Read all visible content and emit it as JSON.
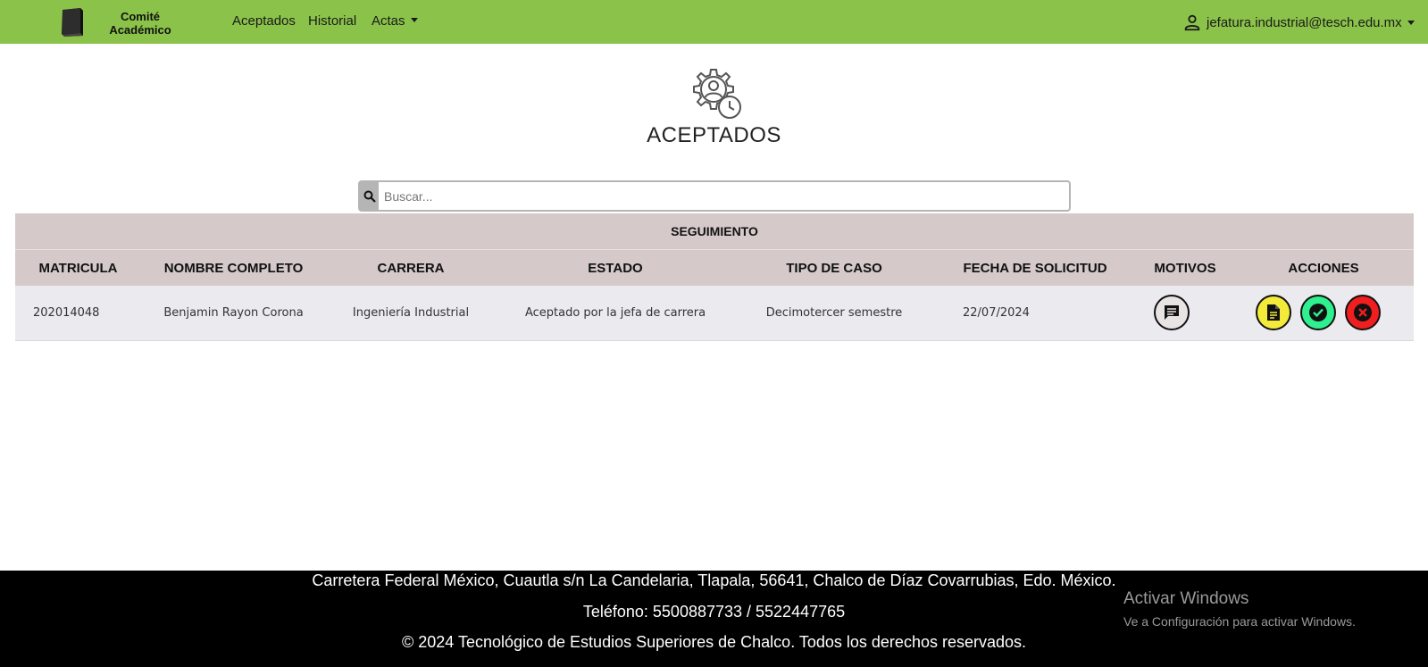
{
  "navbar": {
    "brand_line1": "Comité",
    "brand_line2": "Académico",
    "links": [
      "Aceptados",
      "Historial",
      "Actas"
    ],
    "user_email": "jefatura.industrial@tesch.edu.mx",
    "bg_color": "#8bc34a"
  },
  "page": {
    "title": "ACEPTADOS"
  },
  "search": {
    "placeholder": "Buscar..."
  },
  "table": {
    "band_title": "SEGUIMIENTO",
    "headers": [
      "MATRICULA",
      "NOMBRE COMPLETO",
      "CARRERA",
      "ESTADO",
      "TIPO DE CASO",
      "FECHA DE SOLICITUD",
      "MOTIVOS",
      "ACCIONES"
    ],
    "rows": [
      {
        "matricula": "202014048",
        "nombre": "Benjamin Rayon Corona",
        "carrera": "Ingeniería Industrial",
        "estado": "Aceptado por la jefa de carrera",
        "tipo": "Decimotercer semestre",
        "fecha": "22/07/2024"
      }
    ],
    "icons": {
      "motivos": "comment-icon",
      "doc": "document-icon",
      "ok": "check-circle-icon",
      "x": "cancel-circle-icon"
    }
  },
  "footer": {
    "address": "Carretera Federal México, Cuautla s/n La Candelaria, Tlapala, 56641, Chalco de Díaz Covarrubias, Edo. México.",
    "phone": "Teléfono: 5500887733 / 5522447765",
    "copyright": "© 2024 Tecnológico de Estudios Superiores de Chalco. Todos los derechos reservados."
  },
  "windows_watermark": {
    "title": "Activar Windows",
    "subtitle": "Ve a Configuración para activar Windows."
  }
}
